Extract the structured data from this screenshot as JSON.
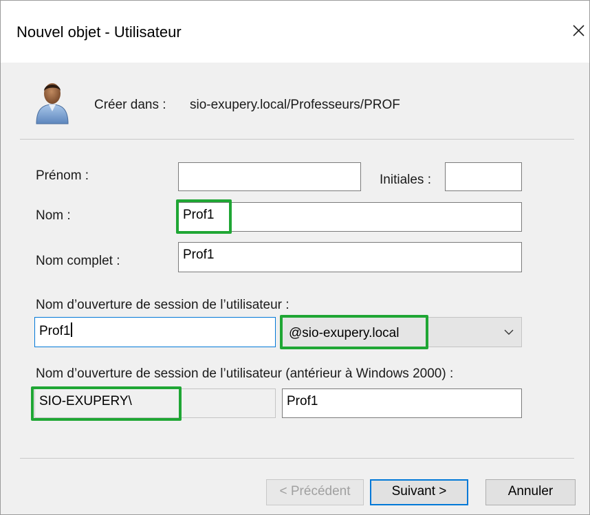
{
  "window": {
    "title": "Nouvel objet - Utilisateur",
    "close_glyph": "×"
  },
  "header": {
    "icon": "user-icon",
    "create_in_label": "Créer dans :",
    "create_in_path": "sio-exupery.local/Professeurs/PROF"
  },
  "form": {
    "first_name_label": "Prénom :",
    "first_name_value": "",
    "initials_label": "Initiales :",
    "initials_value": "",
    "last_name_label": "Nom :",
    "last_name_value": "Prof1",
    "full_name_label": "Nom complet :",
    "full_name_value": "Prof1",
    "logon_label": "Nom d’ouverture de session de l’utilisateur :",
    "logon_value": "Prof1",
    "domain_selected": "@sio-exupery.local",
    "logon_pre2000_label": "Nom d’ouverture de session de l’utilisateur (antérieur à Windows 2000) :",
    "domain_prefix": "SIO-EXUPERY\\",
    "logon_pre2000_value": "Prof1"
  },
  "buttons": {
    "previous": "< Précédent",
    "next": "Suivant >",
    "cancel": "Annuler"
  },
  "colors": {
    "highlight": "#1fa634",
    "focus": "#0078d7"
  }
}
